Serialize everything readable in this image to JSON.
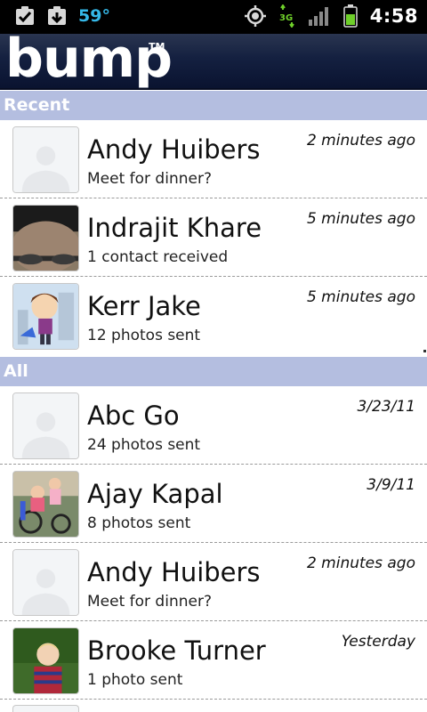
{
  "status_bar": {
    "temperature": "59°",
    "network": "3G",
    "time": "4:58",
    "icons": [
      "checkbox-notification-icon",
      "download-notification-icon",
      "gps-icon",
      "3g-data-icon",
      "signal-strength-icon",
      "battery-icon"
    ]
  },
  "app": {
    "logo": "bump",
    "trademark": "TM"
  },
  "sections": {
    "recent": "Recent",
    "all": "All"
  },
  "recent": [
    {
      "name": "Andy Huibers",
      "subtitle": "Meet for dinner?",
      "time": "2 minutes ago",
      "avatar": "default-contact-avatar"
    },
    {
      "name": "Indrajit Khare",
      "subtitle": "1 contact received",
      "time": "5 minutes ago",
      "avatar": "photo-avatar"
    },
    {
      "name": "Kerr Jake",
      "subtitle": "12 photos sent",
      "time": "5 minutes ago",
      "avatar": "cartoon-avatar"
    }
  ],
  "all": [
    {
      "name": "Abc Go",
      "subtitle": "24 photos sent",
      "time": "3/23/11",
      "avatar": "default-contact-avatar"
    },
    {
      "name": "Ajay Kapal",
      "subtitle": "8 photos sent",
      "time": "3/9/11",
      "avatar": "photo-avatar"
    },
    {
      "name": "Andy Huibers",
      "subtitle": "Meet for dinner?",
      "time": "2 minutes ago",
      "avatar": "default-contact-avatar"
    },
    {
      "name": "Brooke Turner",
      "subtitle": "1 photo sent",
      "time": "Yesterday",
      "avatar": "photo-avatar"
    }
  ],
  "colors": {
    "section_header_bg": "#b4bee0",
    "app_header_bg": "#142040",
    "temperature": "#35b8e8",
    "network_green": "#6fcf2a"
  }
}
